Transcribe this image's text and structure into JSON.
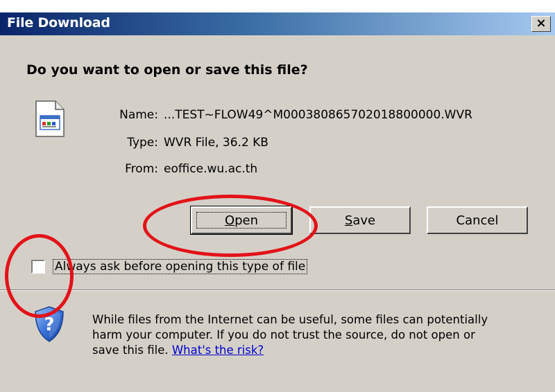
{
  "window": {
    "title": "File Download",
    "close_glyph": "×",
    "titlebar_gradient": [
      "#0a246a",
      "#3a6ea5",
      "#a6caf0"
    ]
  },
  "dialog": {
    "question": "Do you want to open or save this file?",
    "file_icon": "document-icon",
    "fields": [
      {
        "label": "Name:",
        "value": "...TEST~FLOW49^M000380865702018800000.WVR"
      },
      {
        "label": "Type:",
        "value": "WVR File, 36.2 KB"
      },
      {
        "label": "From:",
        "value": "eoffice.wu.ac.th"
      }
    ],
    "buttons": {
      "open": "Open",
      "save": "Save",
      "cancel": "Cancel"
    },
    "checkbox": {
      "label": "Always ask before opening this type of file",
      "checked": false
    },
    "warning": {
      "icon": "shield-question-icon",
      "line1": "While files from the Internet can be useful, some files can potentially",
      "line2": "harm your computer. If you do not trust the source, do not open or",
      "line3_prefix": "save this file. ",
      "link": "What's the risk?"
    }
  },
  "colors": {
    "dialog_background": "#d4d0c8",
    "annotation": "#e31219",
    "link": "#0000cc"
  },
  "annotations": [
    "red-ellipse-open-button",
    "red-ellipse-checkbox"
  ]
}
